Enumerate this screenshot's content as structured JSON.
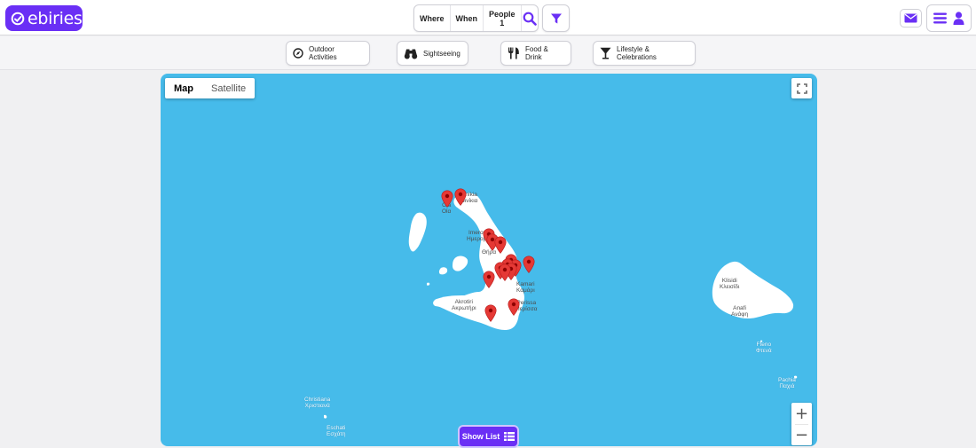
{
  "header": {
    "logo_text": "ebiries",
    "search": {
      "where_label": "Where",
      "when_label": "When",
      "people_label": "People",
      "people_count": "1"
    }
  },
  "categories": [
    {
      "label": "Outdoor Activities",
      "icon": "compass-icon"
    },
    {
      "label": "Sightseeing",
      "icon": "binoculars-icon"
    },
    {
      "label": "Food & Drink",
      "icon": "utensils-icon"
    },
    {
      "label": "Lifestyle & Celebrations",
      "icon": "cocktail-icon"
    }
  ],
  "map": {
    "map_type_options": [
      "Map",
      "Satellite"
    ],
    "selected_map_type": "Map",
    "zoom_in": "+",
    "zoom_out": "−",
    "places": [
      {
        "id": "oia",
        "line1": "Oia",
        "line2": "Οία"
      },
      {
        "id": "finikia",
        "line1": "Foinikia",
        "line2": "Φοινίκια"
      },
      {
        "id": "imerovigli",
        "line1": "Imerovigli",
        "line2": "Ημεροβίγλι"
      },
      {
        "id": "thira",
        "line1": "",
        "line2": "Θήρα"
      },
      {
        "id": "kamari",
        "line1": "Kamari",
        "line2": "Καμάρι"
      },
      {
        "id": "akrotiri",
        "line1": "Akrotiri",
        "line2": "Ακρωτήρι"
      },
      {
        "id": "perissa",
        "line1": "Perissa",
        "line2": "Περίσσα"
      },
      {
        "id": "klisidi",
        "line1": "Klisidi",
        "line2": "Κλεισίδι"
      },
      {
        "id": "anafi",
        "line1": "Anafi",
        "line2": "Ανάφη"
      },
      {
        "id": "fteno",
        "line1": "Fteno",
        "line2": "Φτενά"
      },
      {
        "id": "pachia",
        "line1": "Pachia",
        "line2": "Παχιά"
      },
      {
        "id": "christiana",
        "line1": "Christiana",
        "line2": "Χριστιανά"
      },
      {
        "id": "eschati",
        "line1": "Eschati",
        "line2": "Εσχάτη"
      }
    ],
    "markers_count": 17
  },
  "show_list_label": "Show List",
  "colors": {
    "brand": "#6a2ff5",
    "water": "#46bbea",
    "land": "#ffffff",
    "marker": "#e53935"
  }
}
